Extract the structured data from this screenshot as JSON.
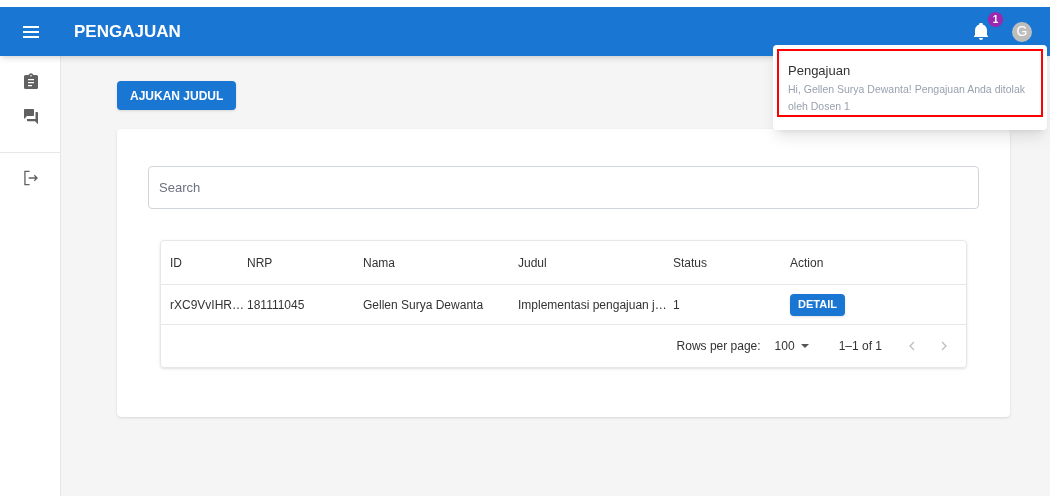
{
  "app_bar": {
    "title": "PENGAJUAN",
    "notification_count": "1",
    "avatar_letter": "G"
  },
  "sidebar": {
    "items": [
      {
        "kind": "assignment"
      },
      {
        "kind": "forum"
      },
      {
        "kind": "logout"
      }
    ]
  },
  "submit_button": "AJUKAN JUDUL",
  "search": {
    "placeholder": "Search"
  },
  "table": {
    "columns": [
      "ID",
      "NRP",
      "Nama",
      "Judul",
      "Status",
      "Action"
    ],
    "rows": [
      {
        "cells": [
          "rXC9VvIHR…",
          "181111045",
          "Gellen Surya Dewanta",
          "Implementasi pengajuan j…",
          "1"
        ],
        "action": "DETAIL"
      }
    ],
    "footer": {
      "rows_per_page_label": "Rows per page:",
      "rows_per_page": "100",
      "range": "1–1 of 1",
      "prev_disabled": true,
      "next_disabled": true
    }
  },
  "notification_popup": {
    "title": "Pengajuan",
    "message": "Hi, Gellen Surya Dewanta! Pengajuan Anda ditolak oleh Dosen 1",
    "highlighted": true
  }
}
